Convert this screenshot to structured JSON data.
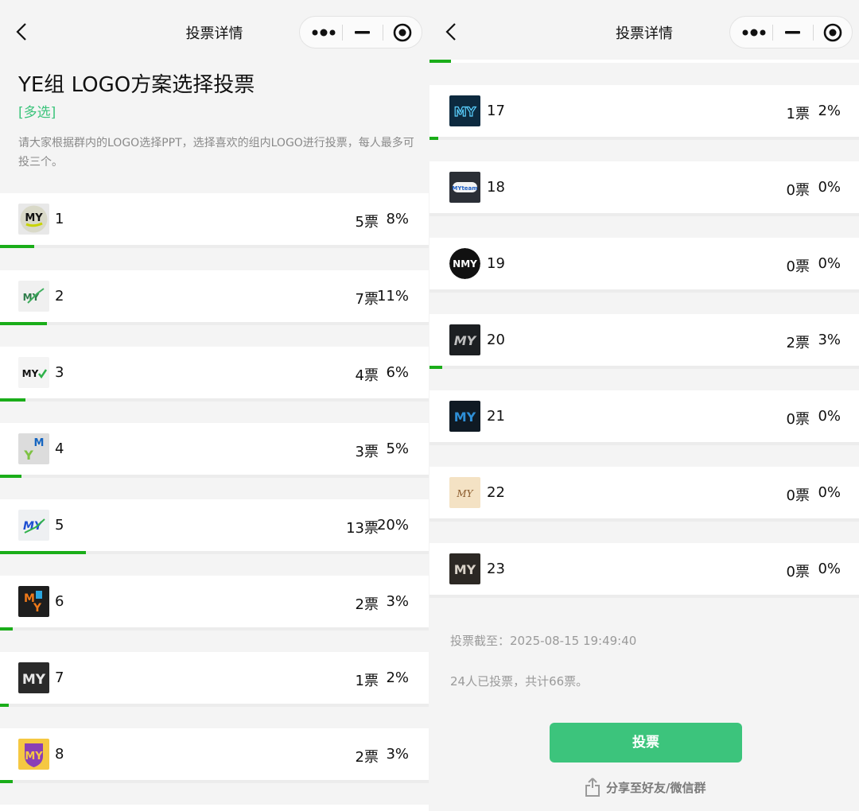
{
  "header": {
    "title": "投票详情"
  },
  "poll": {
    "title": "YE组 LOGO方案选择投票",
    "type": "[多选]",
    "description": "请大家根据群内的LOGO选择PPT，选择喜欢的组内LOGO进行投票，每人最多可投三个。"
  },
  "colors": {
    "accent": "#3cc47c",
    "progress": "#1aad19"
  },
  "options_left": [
    {
      "name": "1",
      "votes": "5票",
      "percent": "8%",
      "fraction": 0.08
    },
    {
      "name": "2",
      "votes": "7票",
      "percent": "11%",
      "fraction": 0.11
    },
    {
      "name": "3",
      "votes": "4票",
      "percent": "6%",
      "fraction": 0.06
    },
    {
      "name": "4",
      "votes": "3票",
      "percent": "5%",
      "fraction": 0.05
    },
    {
      "name": "5",
      "votes": "13票",
      "percent": "20%",
      "fraction": 0.2
    },
    {
      "name": "6",
      "votes": "2票",
      "percent": "3%",
      "fraction": 0.03
    },
    {
      "name": "7",
      "votes": "1票",
      "percent": "2%",
      "fraction": 0.02
    },
    {
      "name": "8",
      "votes": "2票",
      "percent": "3%",
      "fraction": 0.03
    }
  ],
  "previous_option_fraction": 0.05,
  "options_right": [
    {
      "name": "17",
      "votes": "1票",
      "percent": "2%",
      "fraction": 0.02
    },
    {
      "name": "18",
      "votes": "0票",
      "percent": "0%",
      "fraction": 0
    },
    {
      "name": "19",
      "votes": "0票",
      "percent": "0%",
      "fraction": 0
    },
    {
      "name": "20",
      "votes": "2票",
      "percent": "3%",
      "fraction": 0.03
    },
    {
      "name": "21",
      "votes": "0票",
      "percent": "0%",
      "fraction": 0
    },
    {
      "name": "22",
      "votes": "0票",
      "percent": "0%",
      "fraction": 0
    },
    {
      "name": "23",
      "votes": "0票",
      "percent": "0%",
      "fraction": 0
    }
  ],
  "footer": {
    "deadline": "投票截至：2025-08-15 19:49:40",
    "summary": "24人已投票，共计66票。",
    "vote_button": "投票",
    "share_label": "分享至好友/微信群"
  },
  "icons": {
    "back": "chevron-left-icon",
    "more": "more-dots-icon",
    "minimize": "minimize-icon",
    "close": "target-close-icon",
    "share": "share-upload-icon"
  }
}
